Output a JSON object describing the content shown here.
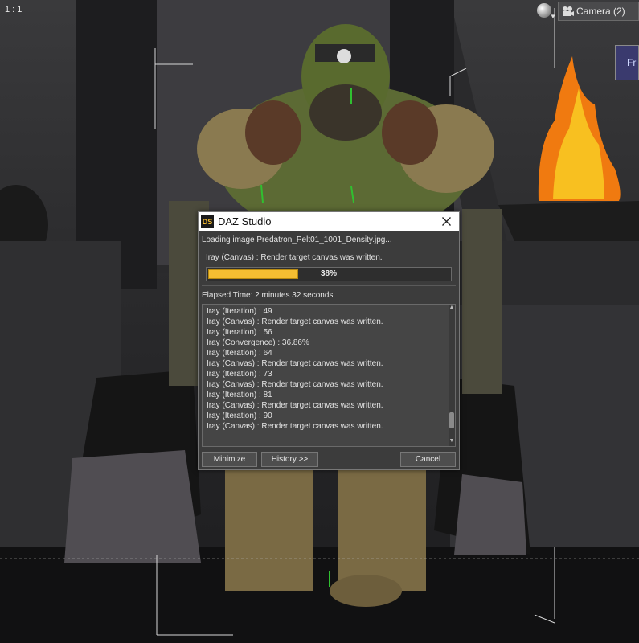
{
  "viewport": {
    "zoom_label": "1 : 1",
    "camera_label": "Camera (2)",
    "view_cube_label": "Fr"
  },
  "dialog": {
    "title": "DAZ Studio",
    "app_icon": "DS",
    "loading_text": "Loading image Predatron_Pelt01_1001_Density.jpg...",
    "status_text": "Iray (Canvas) : Render target canvas was written.",
    "progress_percent": 38,
    "progress_label": "38%",
    "elapsed_text": "Elapsed Time:  2 minutes 32 seconds",
    "log_lines": [
      "Iray (Iteration) : 49",
      "Iray (Canvas) : Render target canvas was written.",
      "Iray (Iteration) : 56",
      "Iray (Convergence) : 36.86%",
      "Iray (Iteration) : 64",
      "Iray (Canvas) : Render target canvas was written.",
      "Iray (Iteration) : 73",
      "Iray (Canvas) : Render target canvas was written.",
      "Iray (Iteration) : 81",
      "Iray (Canvas) : Render target canvas was written.",
      "Iray (Iteration) : 90",
      "Iray (Canvas) : Render target canvas was written."
    ],
    "buttons": {
      "minimize": "Minimize",
      "history": "History >>",
      "cancel": "Cancel"
    }
  },
  "icons": {
    "close": "close-icon",
    "camera": "camera-icon"
  },
  "colors": {
    "progress_fill": "#f4be32",
    "dialog_bg": "#3c3c3c",
    "titlebar_bg": "#ffffff"
  }
}
